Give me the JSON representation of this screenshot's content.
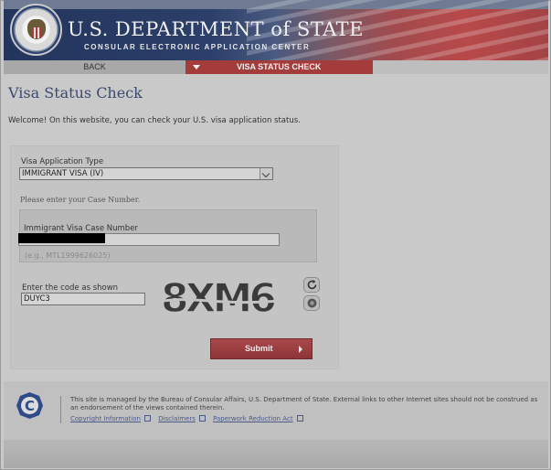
{
  "header": {
    "title": "U.S. DEPARTMENT of STATE",
    "subtitle": "CONSULAR ELECTRONIC APPLICATION CENTER"
  },
  "nav": {
    "back_label": "BACK",
    "active_label": "VISA STATUS CHECK"
  },
  "main": {
    "page_title": "Visa Status Check",
    "welcome": "Welcome! On this website, you can check your U.S. visa application status."
  },
  "form": {
    "app_type_label": "Visa Application Type",
    "app_type_value": "IMMIGRANT VISA (IV)",
    "case_prompt": "Please enter your Case Number.",
    "case_label": "Immigrant Visa Case Number",
    "case_value": "",
    "case_hint": "(e.g., MTL1999626025)",
    "code_label": "Enter the code as shown",
    "code_value": "DUYC3",
    "captcha_text": "8XM6",
    "submit_label": "Submit"
  },
  "footer": {
    "text": "This site is managed by the Bureau of Consular Affairs, U.S. Department of State. External links to other Internet sites should not be construed as an endorsement of the views contained therein.",
    "links": [
      "Copyright Information",
      "Disclaimers",
      "Paperwork Reduction Act"
    ]
  },
  "colors": {
    "accent_red": "#a43c3c",
    "title_blue": "#3a4a70",
    "link_blue": "#4a5a8a"
  }
}
